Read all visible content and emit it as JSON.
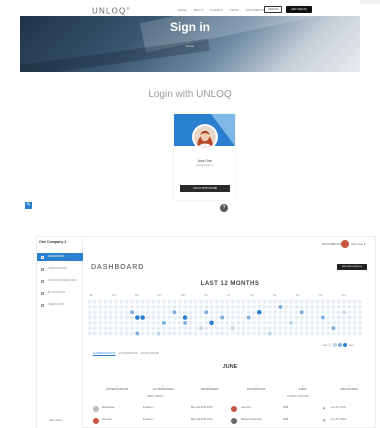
{
  "nav": {
    "logo": "UNLOQ",
    "links": [
      "HOME",
      "ABOUT",
      "CLIENTS",
      "PRICE",
      "DOCUMENTATION"
    ],
    "signin": "SIGN IN",
    "get_unloq": "GET UNLOQ"
  },
  "hero": {
    "title": "Sign in",
    "crumb": "Home"
  },
  "login_title": "Login with UNLOQ",
  "card": {
    "name": "Jane Doe",
    "email": "jane@unloq.io",
    "button": "LOG IN WITH PHONE",
    "help_icon": "help-icon",
    "accent": "#2a80cf"
  },
  "dashboard": {
    "company": "One Company 2",
    "sidebar": [
      {
        "label": "DASHBOARD",
        "active": true
      },
      {
        "label": "APPLICATIONS",
        "active": false
      },
      {
        "label": "CUSTOM DOMAIN ADD",
        "active": false
      },
      {
        "label": "MY ACCOUNT",
        "active": false
      },
      {
        "label": "USERS INTIX",
        "active": false
      }
    ],
    "sidebar_bottom": "Help / Docs",
    "topbar_link": "DOCUMENTATION",
    "user_name": "Jane Doe",
    "title": "DASHBOARD",
    "add_button": "ADD APPLICATION",
    "chart_title": "LAST 12 MONTHS",
    "months": [
      "Jan",
      "Feb",
      "Mar",
      "Apr",
      "May",
      "Jun",
      "Jul",
      "Aug",
      "Sep",
      "Oct",
      "Nov",
      "Dec"
    ],
    "legend_less": "less",
    "legend_more": "more",
    "tabs": [
      "AUTHENTICATIONS",
      "AUTHORIZATION",
      "NOTIFICATIONS"
    ],
    "month_title": "JUNE",
    "stats": [
      {
        "num": "0",
        "label": "AUTHENTICATIONS"
      },
      {
        "num": "0",
        "label": "AUTHORIZATIONS"
      },
      {
        "num": "0",
        "label": "NETWORKERS"
      },
      {
        "num": "0",
        "label": "NOTIFICATIONS"
      },
      {
        "num": "0",
        "label": "USERS"
      },
      {
        "num": "0",
        "label": "APPLICATIONS"
      }
    ],
    "new_users": "NEW USERS",
    "latest_actions": "LATEST ACTIONS",
    "rows": [
      {
        "name": "Mobiusnaes",
        "col2": "Instance 1",
        "col3": "May 14th 2016 06:53",
        "name2": "Jane Doe",
        "col5": "WEB",
        "col6": "Jun 7th, 16:00"
      },
      {
        "name": "Jane Doe",
        "col2": "Instance 1",
        "col3": "May 14th 2016 06:53",
        "name2": "Michael Christensen",
        "col5": "WEB",
        "col6": "Jun 7th, 2016 1"
      }
    ]
  },
  "chart_data": {
    "type": "heatmap",
    "title": "LAST 12 MONTHS",
    "x": [
      "Jan",
      "Feb",
      "Mar",
      "Apr",
      "May",
      "Jun",
      "Jul",
      "Aug",
      "Sep",
      "Oct",
      "Nov",
      "Dec"
    ],
    "rows": 7,
    "weeks": 52,
    "levels": 4,
    "highlighted_cells": [
      [
        8,
        2,
        2
      ],
      [
        9,
        3,
        3
      ],
      [
        10,
        3,
        3
      ],
      [
        9,
        6,
        2
      ],
      [
        14,
        4,
        2
      ],
      [
        16,
        2,
        2
      ],
      [
        18,
        3,
        3
      ],
      [
        18,
        4,
        2
      ],
      [
        21,
        5,
        1
      ],
      [
        22,
        2,
        2
      ],
      [
        23,
        4,
        3
      ],
      [
        25,
        3,
        2
      ],
      [
        30,
        3,
        2
      ],
      [
        32,
        2,
        3
      ],
      [
        36,
        1,
        2
      ],
      [
        38,
        4,
        1
      ],
      [
        40,
        2,
        2
      ],
      [
        44,
        3,
        2
      ],
      [
        13,
        6,
        1
      ],
      [
        27,
        5,
        1
      ],
      [
        34,
        6,
        1
      ],
      [
        46,
        5,
        2
      ],
      [
        48,
        2,
        1
      ]
    ],
    "colors": [
      "#e8eef5",
      "#bcd6ee",
      "#7fb1e0",
      "#2a80cf"
    ]
  }
}
